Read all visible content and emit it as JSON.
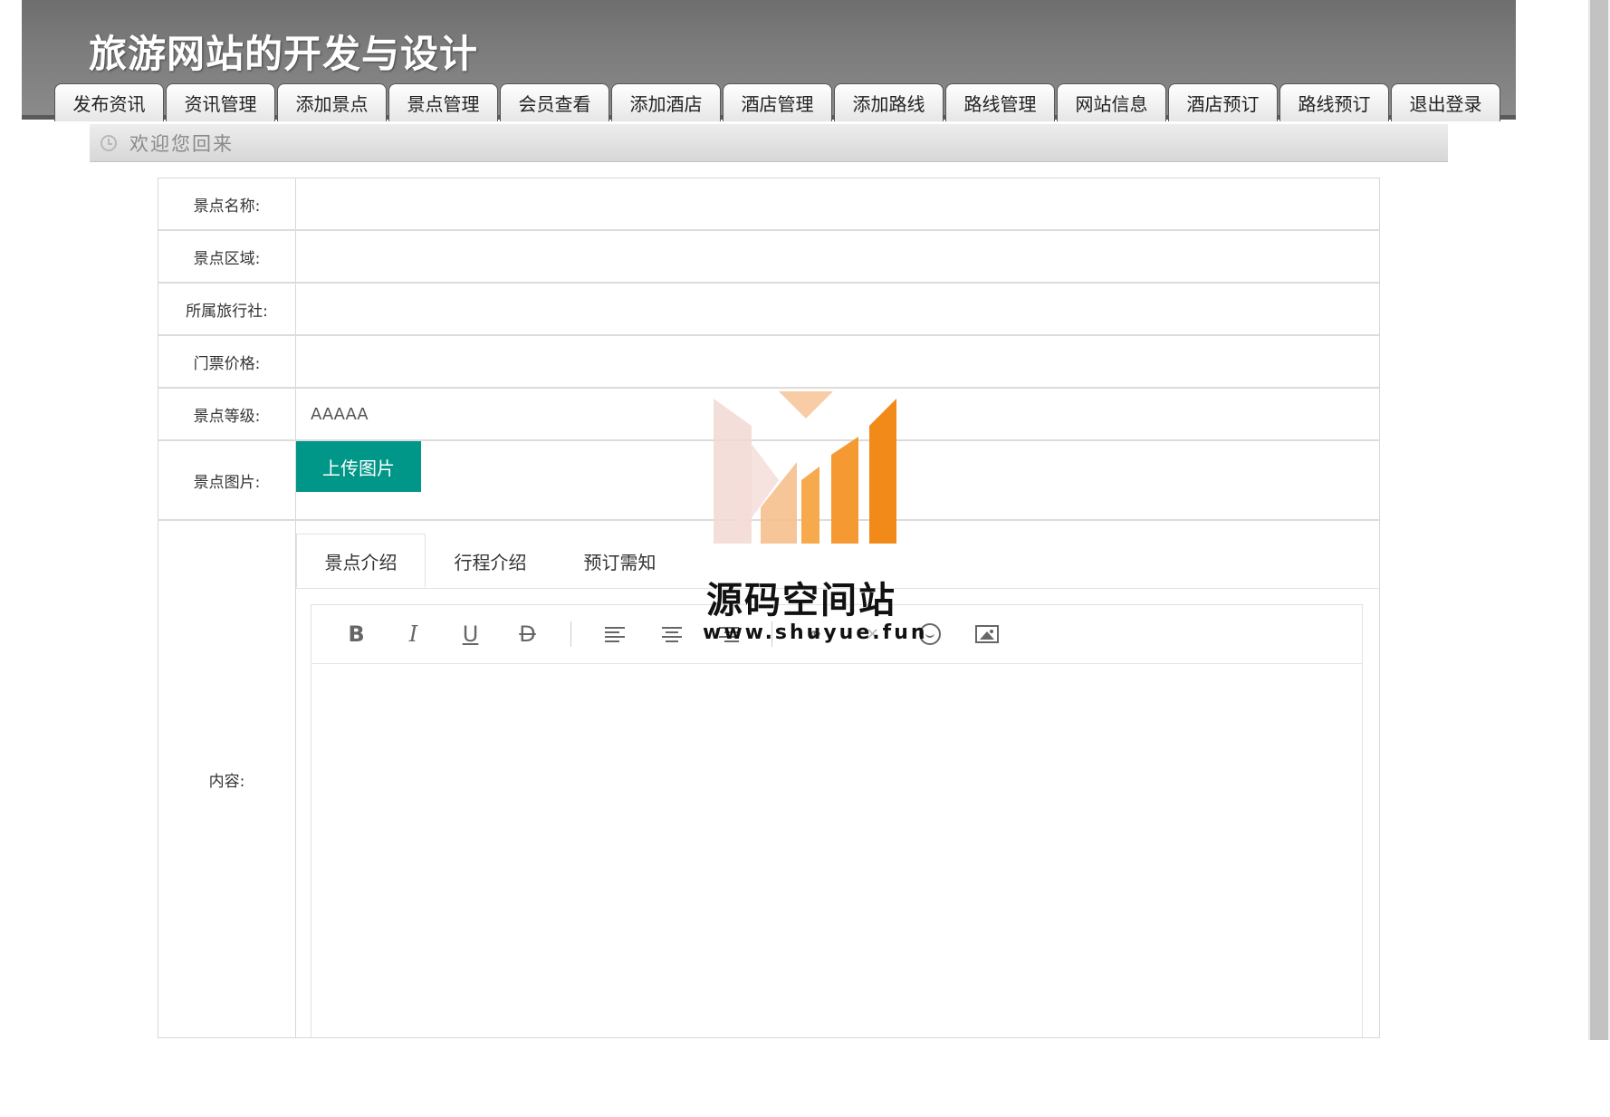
{
  "header": {
    "title": "旅游网站的开发与设计"
  },
  "nav": {
    "items": [
      "发布资讯",
      "资讯管理",
      "添加景点",
      "景点管理",
      "会员查看",
      "添加酒店",
      "酒店管理",
      "添加路线",
      "路线管理",
      "网站信息",
      "酒店预订",
      "路线预订",
      "退出登录"
    ]
  },
  "welcome": {
    "text": "欢迎您回来"
  },
  "form": {
    "name_label": "景点名称:",
    "name_value": "",
    "region_label": "景点区域:",
    "region_value": "",
    "agency_label": "所属旅行社:",
    "agency_value": "",
    "price_label": "门票价格:",
    "price_value": "",
    "level_label": "景点等级:",
    "level_value": "AAAAA",
    "image_label": "景点图片:",
    "upload_label": "上传图片",
    "content_label": "内容:"
  },
  "content_tabs": [
    "景点介绍",
    "行程介绍",
    "预订需知"
  ],
  "toolbar": {
    "bold": "B",
    "italic": "I",
    "underline": "U",
    "strike": "D"
  },
  "watermark": {
    "name": "源码空间站",
    "url": "www.shuyue.fun"
  },
  "colors": {
    "upload_button": "#009688",
    "header": "#7b7b7b",
    "watermark_orange": "#f28a1a"
  }
}
